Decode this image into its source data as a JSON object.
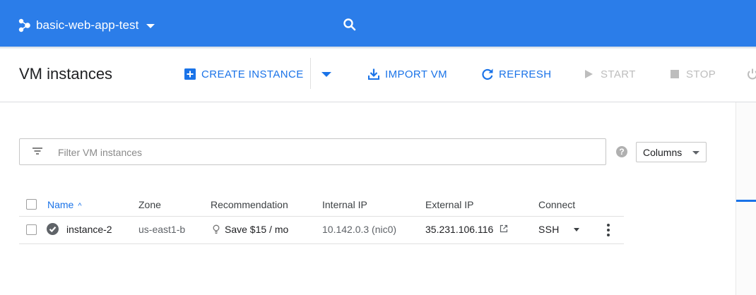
{
  "header": {
    "project_name": "basic-web-app-test",
    "project_icon": "project-hub-icon",
    "search_icon": "search-icon",
    "bar_color": "#2b7de9"
  },
  "toolbar": {
    "page_title": "VM instances",
    "create_instance": "CREATE INSTANCE",
    "import_vm": "IMPORT VM",
    "refresh": "REFRESH",
    "start": "START",
    "stop": "STOP",
    "accent_color": "#1a73e8",
    "disabled_color": "#bdbdbd"
  },
  "filter": {
    "placeholder": "Filter VM instances",
    "value": "",
    "columns_label": "Columns"
  },
  "table": {
    "headers": [
      "Name",
      "Zone",
      "Recommendation",
      "Internal IP",
      "External IP",
      "Connect"
    ],
    "sort_column": "Name",
    "sort_direction": "ascending",
    "rows": [
      {
        "name": "instance-2",
        "status": "running",
        "zone": "us-east1-b",
        "recommendation": "Save $15 / mo",
        "internal_ip": "10.142.0.3 (nic0)",
        "external_ip": "35.231.106.116",
        "connect": "SSH"
      }
    ]
  }
}
